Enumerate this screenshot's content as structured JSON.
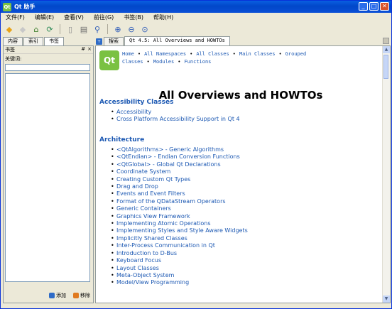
{
  "window": {
    "title": "Qt 助手",
    "app_icon": "Qt",
    "minimize": "_",
    "maximize": "□",
    "close": "✕"
  },
  "menu": [
    "文件(F)",
    "编辑(E)",
    "查看(V)",
    "前往(G)",
    "书签(B)",
    "帮助(H)"
  ],
  "toolbar": [
    {
      "name": "back-icon",
      "glyph": "◆",
      "color": "#E8A317"
    },
    {
      "name": "forward-icon",
      "glyph": "◆",
      "color": "#C8C8C8"
    },
    {
      "name": "home-icon",
      "glyph": "⌂",
      "color": "#3A7D2A"
    },
    {
      "name": "sync-toc-icon",
      "glyph": "⟳",
      "color": "#2E8B57"
    },
    {
      "name": "copy-icon",
      "glyph": "▯",
      "color": "#8C8C8C"
    },
    {
      "name": "print-icon",
      "glyph": "▤",
      "color": "#6B6B6B"
    },
    {
      "name": "find-icon",
      "glyph": "⚲",
      "color": "#2E5CB8"
    },
    {
      "name": "zoom-in-icon",
      "glyph": "⊕",
      "color": "#2E5CB8"
    },
    {
      "name": "zoom-out-icon",
      "glyph": "⊖",
      "color": "#2E5CB8"
    },
    {
      "name": "zoom-reset-icon",
      "glyph": "⊙",
      "color": "#2E5CB8"
    }
  ],
  "left_panel": {
    "tabs": [
      "内容",
      "索引",
      "书签"
    ],
    "active_tab": 2,
    "dock_title": "书签",
    "dock_float": "#",
    "dock_close": "×",
    "keyword_label": "关键词:",
    "add_label": "添加",
    "remove_label": "移除"
  },
  "right_panel": {
    "tabs": [
      "搜索",
      "Qt 4.5: All Overviews and HOWTOs"
    ],
    "active_tab": 1
  },
  "page": {
    "logo": "Qt",
    "nav": [
      "Home",
      "All Namespaces",
      "All Classes",
      "Main Classes",
      "Grouped Classes",
      "Modules",
      "Functions"
    ],
    "title": "All Overviews and HOWTOs",
    "sections": [
      {
        "heading": "Accessibility Classes",
        "items": [
          "Accessibility",
          "Cross Platform Accessibility Support in Qt 4"
        ]
      },
      {
        "heading": "Architecture",
        "items": [
          "<QtAlgorithms> - Generic Algorithms",
          "<QtEndian> - Endian Conversion Functions",
          "<QtGlobal> - Global Qt Declarations",
          "Coordinate System",
          "Creating Custom Qt Types",
          "Drag and Drop",
          "Events and Event Filters",
          "Format of the QDataStream Operators",
          "Generic Containers",
          "Graphics View Framework",
          "Implementing Atomic Operations",
          "Implementing Styles and Style Aware Widgets",
          "Implicitly Shared Classes",
          "Inter-Process Communication in Qt",
          "Introduction to D-Bus",
          "Keyboard Focus",
          "Layout Classes",
          "Meta-Object System",
          "Model/View Programming"
        ]
      }
    ]
  },
  "colors": {
    "link": "#1D59B3",
    "titlebar": "#0A5FE0",
    "chrome": "#ECE9D8"
  }
}
